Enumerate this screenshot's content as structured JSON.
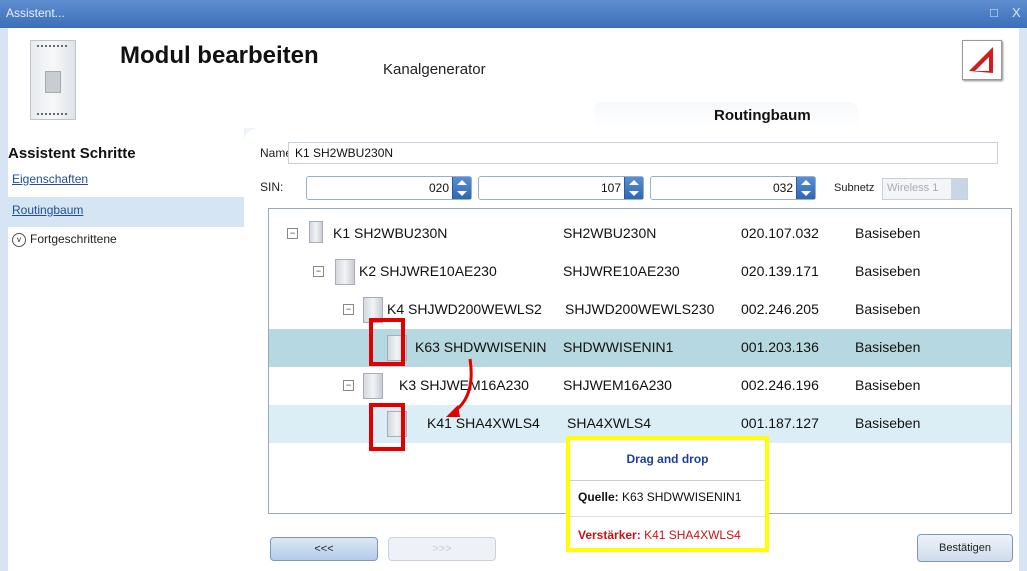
{
  "window": {
    "title": "Assistent...",
    "controls": "□ X"
  },
  "header": {
    "title": "Modul bearbeiten",
    "subtitle": "Kanalgenerator",
    "tab": "Routingbaum"
  },
  "sidebar": {
    "heading": "Assistent Schritte",
    "items": [
      {
        "label": "Eigenschaften"
      },
      {
        "label": "Routingbaum"
      },
      {
        "label": "Fortgeschrittene"
      }
    ]
  },
  "form": {
    "name_label": "Name",
    "name_value": "K1 SH2WBU230N",
    "sin_label": "SIN:",
    "sin_values": [
      "020",
      "107",
      "032"
    ],
    "subnet_label": "Subnetz",
    "subnet_value": "Wireless 1"
  },
  "tree": {
    "rows": [
      {
        "name": "K1 SH2WBU230N",
        "type": "SH2WBU230N",
        "sin": "020.107.032",
        "level": "Basiseben"
      },
      {
        "name": "K2 SHJWRE10AE230",
        "type": "SHJWRE10AE230",
        "sin": "020.139.171",
        "level": "Basiseben"
      },
      {
        "name": "K4 SHJWD200WEWLS2",
        "type": "SHJWD200WEWLS230",
        "sin": "002.246.205",
        "level": "Basiseben"
      },
      {
        "name": "K63 SHDWWISENIN",
        "type": "SHDWWISENIN1",
        "sin": "001.203.136",
        "level": "Basiseben"
      },
      {
        "name": "K3 SHJWEM16A230",
        "type": "SHJWEM16A230",
        "sin": "002.246.196",
        "level": "Basiseben"
      },
      {
        "name": "K41 SHA4XWLS4",
        "type": "SHA4XWLS4",
        "sin": "001.187.127",
        "level": "Basiseben"
      }
    ]
  },
  "buttons": {
    "back": "<<<",
    "next": ">>>",
    "confirm": "Bestätigen"
  },
  "callout": {
    "title": "Drag and drop",
    "source_label": "Quelle:",
    "source_value": "K63 SHDWWISENIN1",
    "repeater_label": "Verstärker:",
    "repeater_value": "K41 SHA4XWLS4"
  },
  "colors": {
    "selected_row": "#b6d8e0",
    "highlight_row": "#dceef5",
    "annotation_red": "#e00000",
    "callout_border": "#ffff00"
  }
}
